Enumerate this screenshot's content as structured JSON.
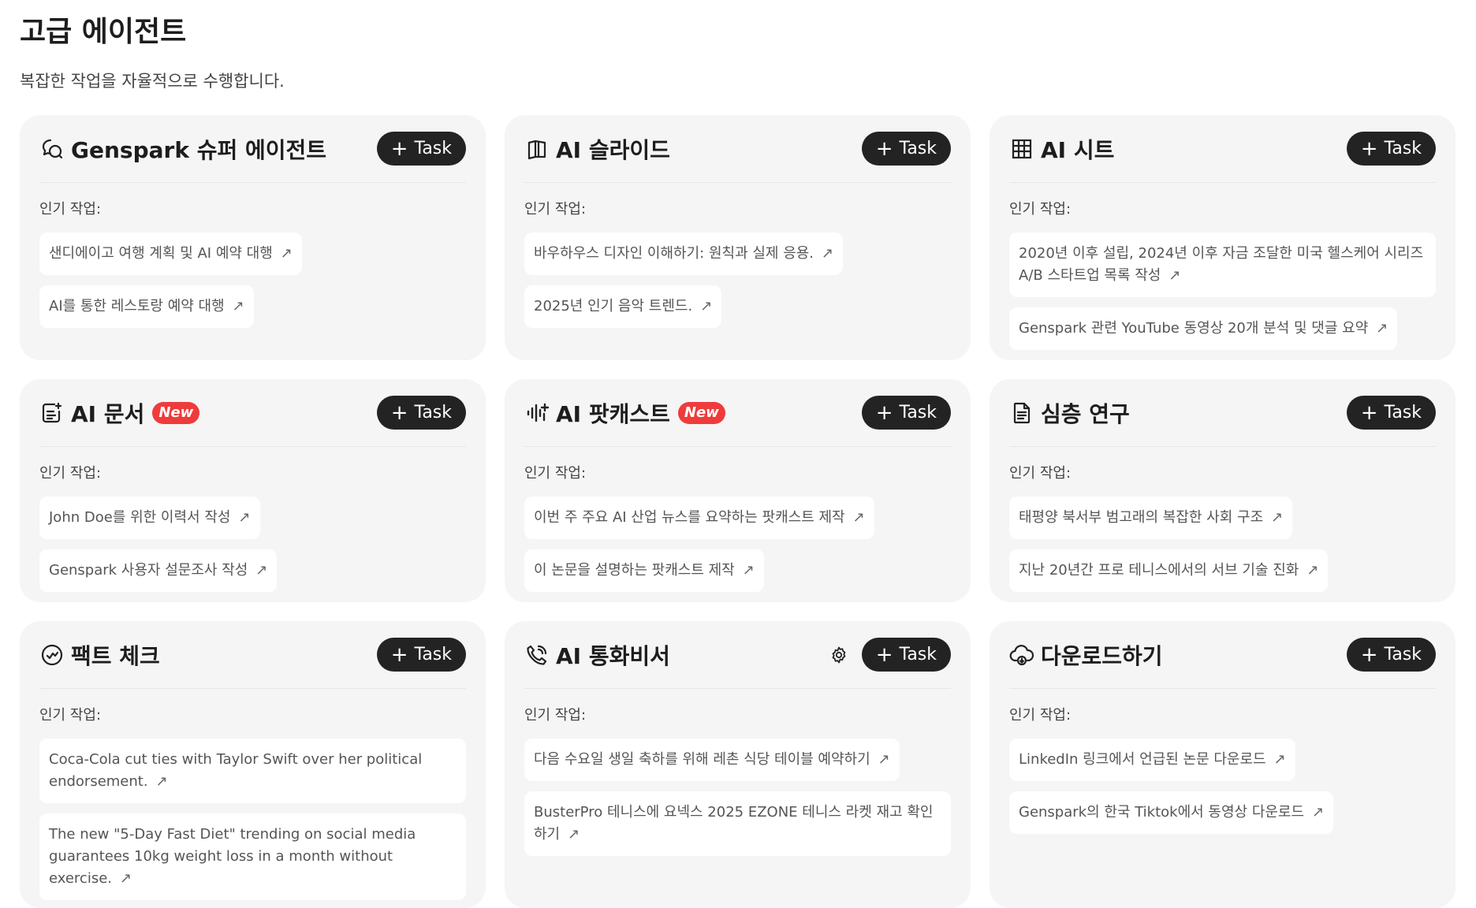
{
  "page": {
    "title": "고급 에이전트",
    "subtitle": "복잡한 작업을 자율적으로 수행합니다."
  },
  "common": {
    "task_label": "Task",
    "popular_label": "인기 작업:",
    "new_badge": "New",
    "arrow": "↗"
  },
  "cards": [
    {
      "title": "Genspark 슈퍼 에이전트",
      "icon": "chat-bubbles-icon",
      "items": [
        "샌디에이고 여행 계획 및 AI 예약 대행",
        "AI를 통한 레스토랑 예약 대행"
      ]
    },
    {
      "title": "AI 슬라이드",
      "icon": "slides-book-icon",
      "items": [
        "바우하우스 디자인 이해하기: 원칙과 실제 응용.",
        "2025년 인기 음악 트렌드."
      ]
    },
    {
      "title": "AI 시트",
      "icon": "grid-table-icon",
      "items": [
        "2020년 이후 설립, 2024년 이후 자금 조달한 미국 헬스케어 시리즈 A/B 스타트업 목록 작성",
        "Genspark 관련 YouTube 동영상 20개 분석 및 댓글 요약"
      ]
    },
    {
      "title": "AI 문서",
      "icon": "document-edit-icon",
      "new": true,
      "items": [
        "John Doe를 위한 이력서 작성",
        "Genspark 사용자 설문조사 작성"
      ]
    },
    {
      "title": "AI 팟캐스트",
      "icon": "audio-wave-icon",
      "new": true,
      "items": [
        "이번 주 주요 AI 산업 뉴스를 요약하는 팟캐스트 제작",
        "이 논문을 설명하는 팟캐스트 제작"
      ]
    },
    {
      "title": "심층 연구",
      "icon": "file-text-icon",
      "items": [
        "태평양 북서부 범고래의 복잡한 사회 구조",
        "지난 20년간 프로 테니스에서의 서브 기술 진화"
      ]
    },
    {
      "title": "팩트 체크",
      "icon": "check-circle-icon",
      "items": [
        "Coca-Cola cut ties with Taylor Swift over her political endorsement.",
        "The new \"5-Day Fast Diet\" trending on social media guarantees 10kg weight loss in a month without exercise."
      ]
    },
    {
      "title": "AI 통화비서",
      "icon": "phone-call-icon",
      "has_settings": true,
      "items": [
        "다음 수요일 생일 축하를 위해 레촌 식당 테이블 예약하기",
        "BusterPro 테니스에 요넥스 2025 EZONE 테니스 라켓 재고 확인하기"
      ]
    },
    {
      "title": "다운로드하기",
      "icon": "cloud-download-icon",
      "items": [
        "LinkedIn 링크에서 언급된 논문 다운로드",
        "Genspark의 한국 Tiktok에서 동영상 다운로드"
      ]
    }
  ]
}
